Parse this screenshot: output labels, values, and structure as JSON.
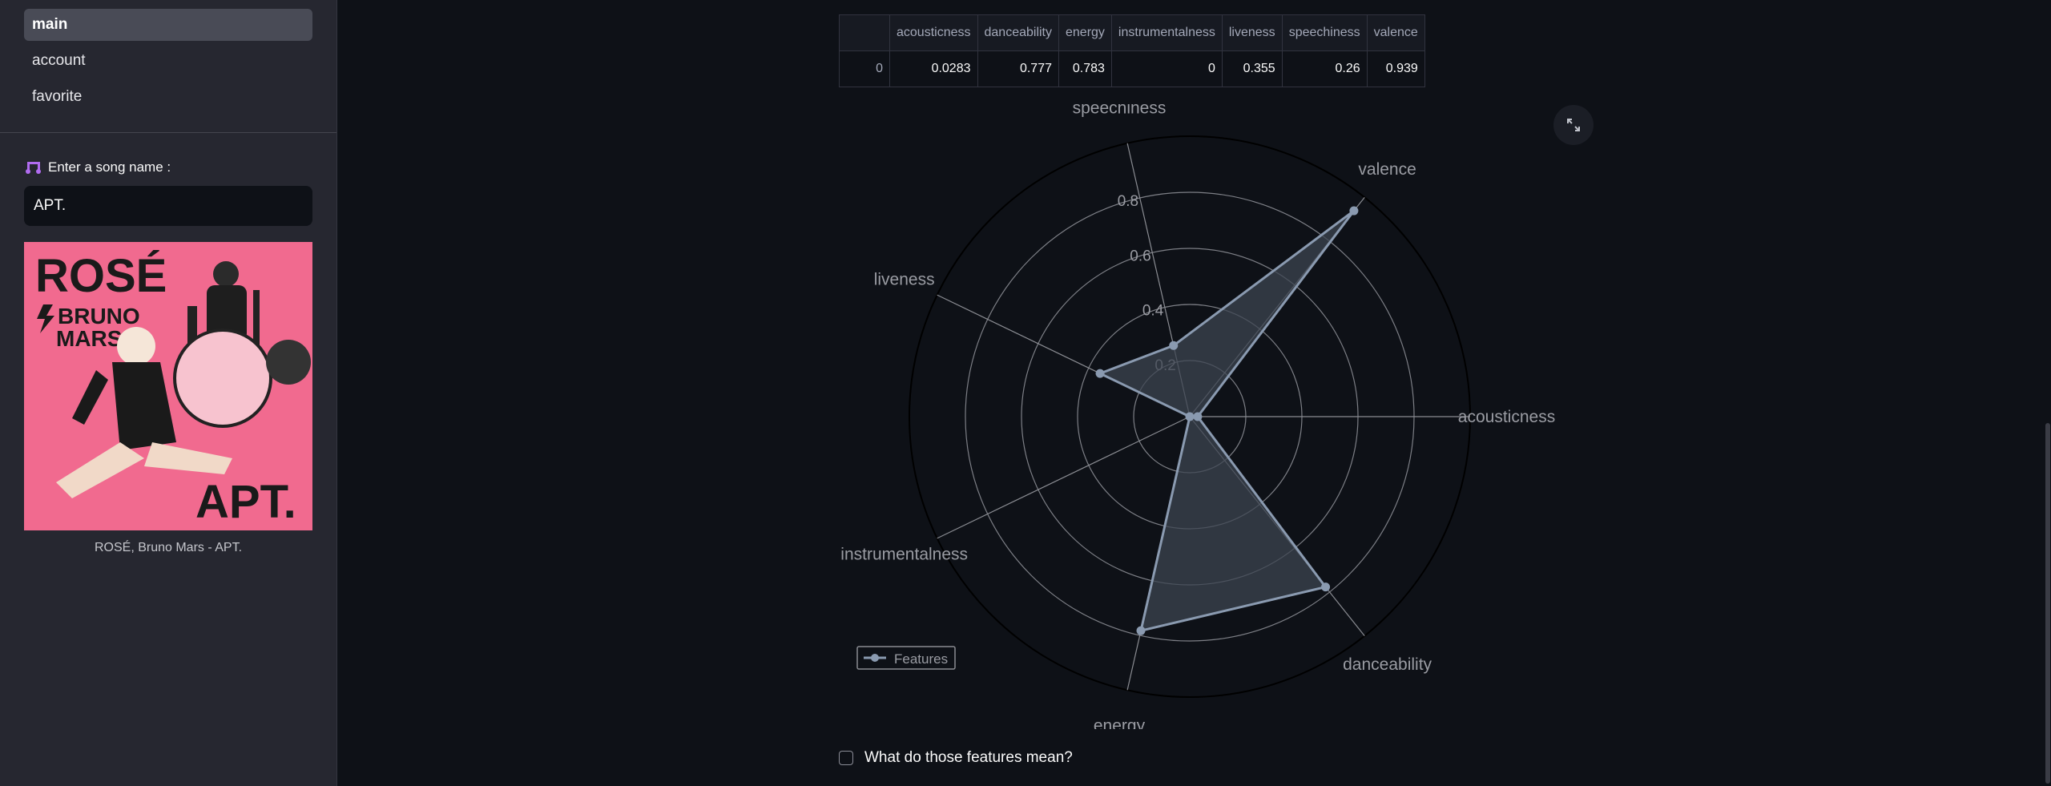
{
  "sidebar": {
    "nav": [
      {
        "label": "main",
        "active": true
      },
      {
        "label": "account",
        "active": false
      },
      {
        "label": "favorite",
        "active": false
      }
    ],
    "song_label": "Enter a song name :",
    "song_input_value": "APT.",
    "cover": {
      "title_line1": "ROSÉ",
      "title_line2": "BRUNO",
      "title_line3": "MARS",
      "album_word": "APT."
    },
    "caption": "ROSÉ, Bruno Mars - APT."
  },
  "table": {
    "headers": [
      "",
      "acousticness",
      "danceability",
      "energy",
      "instrumentalness",
      "liveness",
      "speechiness",
      "valence"
    ],
    "rows": [
      [
        "0",
        "0.0283",
        "0.777",
        "0.783",
        "0",
        "0.355",
        "0.26",
        "0.939"
      ]
    ]
  },
  "chart_data": {
    "type": "radar",
    "categories": [
      "acousticness",
      "danceability",
      "energy",
      "instrumentalness",
      "liveness",
      "speechiness",
      "valence"
    ],
    "series": [
      {
        "name": "Features",
        "values": [
          0.0283,
          0.777,
          0.783,
          0,
          0.355,
          0.26,
          0.939
        ]
      }
    ],
    "radial_ticks": [
      "0.2",
      "0.4",
      "0.6",
      "0.8"
    ],
    "radial_range": [
      0,
      1
    ],
    "legend_position": "bottom-left",
    "colors": {
      "series": "#8a9ab0",
      "fill": "#3c4450",
      "grid": "#8a8c92",
      "text": "#9a9ca3"
    }
  },
  "checkbox": {
    "label": "What do those features mean?",
    "checked": false
  },
  "colors": {
    "accent": "#f16a8f",
    "background": "#0e1117",
    "sidebar": "#262730"
  }
}
